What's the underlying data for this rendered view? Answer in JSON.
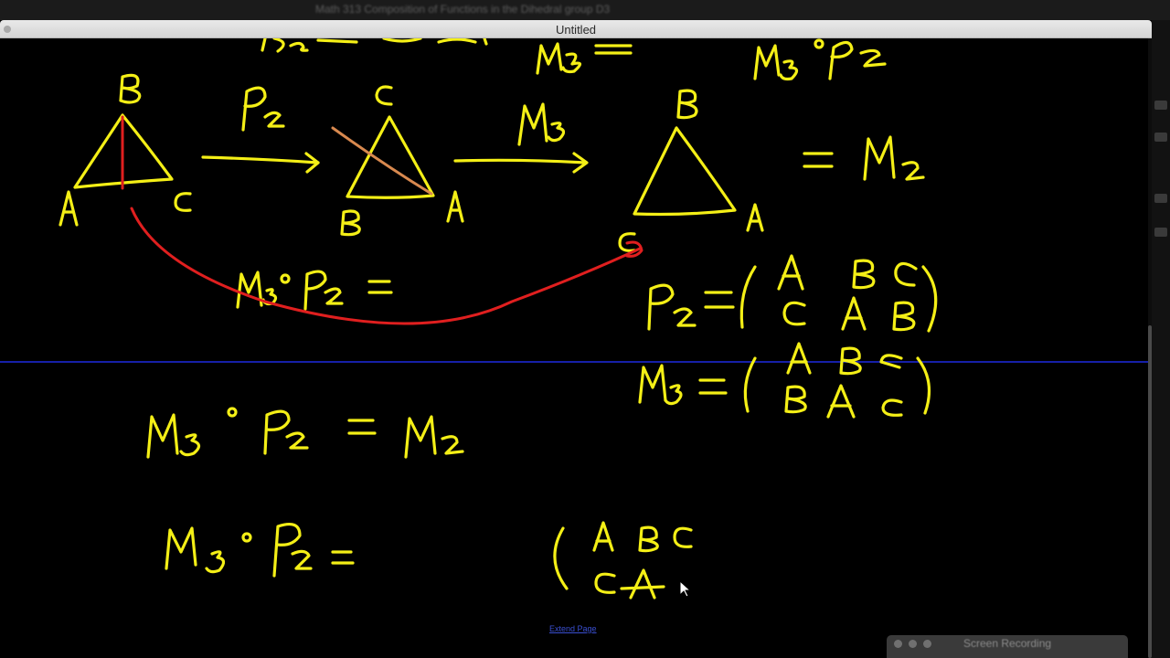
{
  "window": {
    "title": "Untitled",
    "background_text": "Math 313 Composition of Functions in the Dihedral group D3"
  },
  "extend_link": "Extend Page",
  "recording_window": {
    "title": "Screen Recording"
  },
  "colors": {
    "ink_yellow": "#f4ef16",
    "ink_red": "#e01f1f",
    "ink_orange": "#d8894f",
    "divider_blue": "#1620a8",
    "background": "#000000"
  }
}
